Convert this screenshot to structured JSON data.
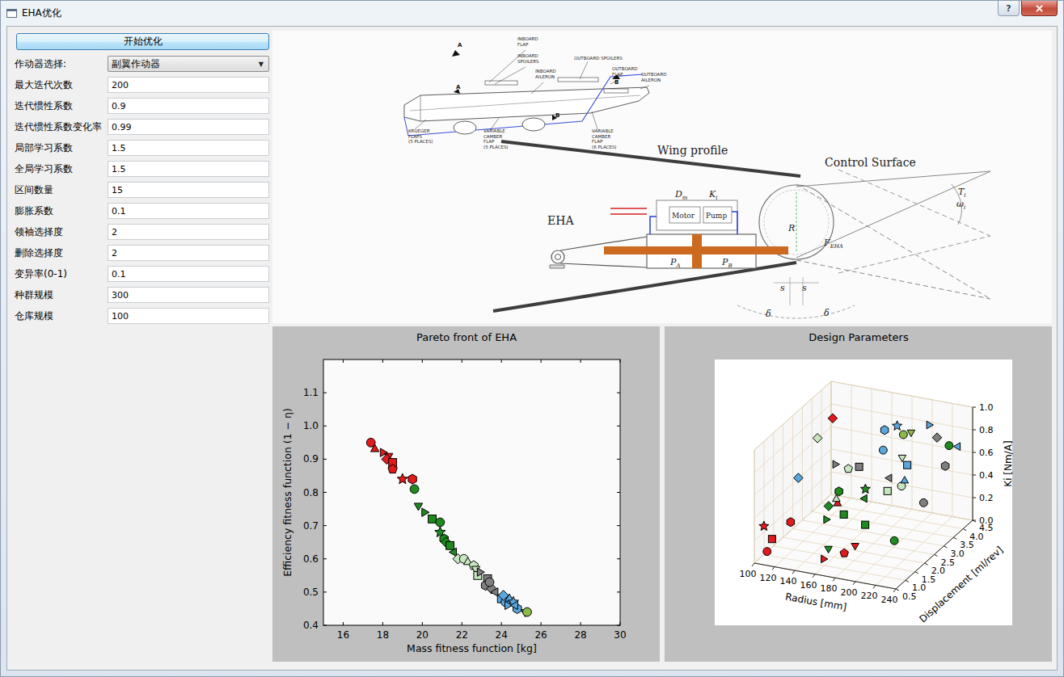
{
  "window": {
    "title": "EHA优化",
    "help": "?",
    "close": "×"
  },
  "sidebar": {
    "start_button": "开始优化",
    "actuator": {
      "label": "作动器选择:",
      "value": "副翼作动器",
      "arrow": "▼"
    },
    "fields": [
      {
        "label": "最大迭代次数",
        "value": "200"
      },
      {
        "label": "迭代惯性系数",
        "value": "0.9"
      },
      {
        "label": "迭代惯性系数变化率",
        "value": "0.99"
      },
      {
        "label": "局部学习系数",
        "value": "1.5"
      },
      {
        "label": "全局学习系数",
        "value": "1.5"
      },
      {
        "label": "区间数量",
        "value": "15"
      },
      {
        "label": "膨胀系数",
        "value": "0.1"
      },
      {
        "label": "领袖选择度",
        "value": "2"
      },
      {
        "label": "删除选择度",
        "value": "2"
      },
      {
        "label": "变异率(0-1)",
        "value": "0.1"
      },
      {
        "label": "种群规模",
        "value": "300"
      },
      {
        "label": "仓库规模",
        "value": "100"
      }
    ]
  },
  "diagram": {
    "airplane_labels": [
      {
        "lines": [
          "INBOARD",
          "FLAP"
        ]
      },
      {
        "lines": [
          "INBOARD",
          "SPOILERS"
        ]
      },
      {
        "lines": [
          "INBOARD",
          "AILERON"
        ]
      },
      {
        "lines": [
          "OUTBOARD SPOILERS"
        ]
      },
      {
        "lines": [
          "OUTBOARD",
          "FLAP"
        ]
      },
      {
        "lines": [
          "OUTBOARD",
          "AILERON"
        ]
      },
      {
        "lines": [
          "KRUEGER",
          "FLAPS",
          "(5 PLACES)"
        ]
      },
      {
        "lines": [
          "VARIABLE",
          "CAMBER",
          "FLAP",
          "(5 PLACES)"
        ]
      },
      {
        "lines": [
          "VARIABLE",
          "CAMBER",
          "FLAP",
          "(6 PLACES)"
        ]
      }
    ],
    "section_markers": [
      "A",
      "A",
      "B",
      "B"
    ],
    "wing_profile": "Wing profile",
    "control_surface": "Control Surface",
    "eha": "EHA",
    "motor": "Motor",
    "pump": "Pump",
    "symbols": [
      {
        "text": "D",
        "sub": "m"
      },
      {
        "text": "K",
        "sub": "i"
      },
      {
        "text": "R",
        "sub": ""
      },
      {
        "text": "P",
        "sub": "A"
      },
      {
        "text": "P",
        "sub": "B"
      },
      {
        "text": "F",
        "sub": "EHA"
      },
      {
        "text": "s",
        "sub": ""
      },
      {
        "text": "s",
        "sub": ""
      },
      {
        "text": "δ",
        "sub": ""
      },
      {
        "text": "δ",
        "sub": ""
      },
      {
        "text": "T",
        "sub": "i"
      },
      {
        "text": "ω",
        "sub": "i"
      }
    ]
  },
  "pareto_chart": {
    "title": "Pareto front of EHA",
    "x_label": "Mass fitness function [kg]",
    "y_label": "Efficiency fitness function (1 − η)",
    "x_range": [
      15,
      30
    ],
    "y_range": [
      0.4,
      1.2
    ],
    "x_ticks": [
      "16",
      "18",
      "20",
      "22",
      "24",
      "26",
      "28",
      "30"
    ],
    "y_ticks": [
      "0.4",
      "0.5",
      "0.6",
      "0.7",
      "0.8",
      "0.9",
      "1.0",
      "1.1"
    ]
  },
  "design_chart": {
    "title": "Design Parameters",
    "x_label": "Radius [mm]",
    "y_label": "Displacement [ml/rev]",
    "z_label": "Ki [Nm/A]",
    "x_range": [
      100,
      240
    ],
    "y_range": [
      0.5,
      4.5
    ],
    "z_range": [
      0,
      1
    ],
    "x_ticks": [
      "100",
      "120",
      "140",
      "160",
      "180",
      "200",
      "220",
      "240"
    ],
    "y_ticks": [
      "0.5",
      "1.0",
      "1.5",
      "2.0",
      "2.5",
      "3.0",
      "3.5",
      "4.0",
      "4.5"
    ],
    "z_ticks": [
      "0.0",
      "0.2",
      "0.4",
      "0.6",
      "0.8",
      "1.0"
    ]
  },
  "designs": [
    {
      "mass": 17.4,
      "efficiency": 0.95,
      "radius": 105,
      "displacement": 0.9,
      "ki": 0.05,
      "color": "#e31a1c",
      "marker": "circle"
    },
    {
      "mass": 17.6,
      "efficiency": 0.93,
      "radius": 150,
      "displacement": 2.2,
      "ki": 0.35,
      "color": "#e31a1c",
      "marker": "triangle"
    },
    {
      "mass": 18.0,
      "efficiency": 0.92,
      "radius": 155,
      "displacement": 1.2,
      "ki": 0.02,
      "color": "#e31a1c",
      "marker": "triangle-right"
    },
    {
      "mass": 18.3,
      "efficiency": 0.91,
      "radius": 175,
      "displacement": 1.8,
      "ki": 0.08,
      "color": "#e31a1c",
      "marker": "triangle-down"
    },
    {
      "mass": 18.2,
      "efficiency": 0.9,
      "radius": 130,
      "displacement": 3.0,
      "ki": 0.95,
      "color": "#e31a1c",
      "marker": "diamond"
    },
    {
      "mass": 18.5,
      "efficiency": 0.89,
      "radius": 108,
      "displacement": 1.0,
      "ki": 0.15,
      "color": "#e31a1c",
      "marker": "square"
    },
    {
      "mass": 18.5,
      "efficiency": 0.87,
      "radius": 170,
      "displacement": 1.5,
      "ki": 0.05,
      "color": "#e31a1c",
      "marker": "pentagon"
    },
    {
      "mass": 19.0,
      "efficiency": 0.84,
      "radius": 100,
      "displacement": 1.0,
      "ki": 0.25,
      "color": "#e31a1c",
      "marker": "star"
    },
    {
      "mass": 19.5,
      "efficiency": 0.84,
      "radius": 115,
      "displacement": 1.6,
      "ki": 0.22,
      "color": "#e31a1c",
      "marker": "hexagon"
    },
    {
      "mass": 19.6,
      "efficiency": 0.81,
      "radius": 210,
      "displacement": 2.0,
      "ki": 0.15,
      "color": "#1f8b1f",
      "marker": "circle"
    },
    {
      "mass": 19.8,
      "efficiency": 0.76,
      "radius": 160,
      "displacement": 1.2,
      "ki": 0.12,
      "color": "#1f8b1f",
      "marker": "triangle-down"
    },
    {
      "mass": 20.1,
      "efficiency": 0.74,
      "radius": 150,
      "displacement": 1.6,
      "ki": 0.3,
      "color": "#1f8b1f",
      "marker": "triangle-right"
    },
    {
      "mass": 20.5,
      "efficiency": 0.72,
      "radius": 185,
      "displacement": 1.8,
      "ki": 0.28,
      "color": "#1f8b1f",
      "marker": "square"
    },
    {
      "mass": 20.9,
      "efficiency": 0.71,
      "radius": 230,
      "displacement": 3.8,
      "ki": 0.75,
      "color": "#1f8b1f",
      "marker": "circle"
    },
    {
      "mass": 20.9,
      "efficiency": 0.68,
      "radius": 170,
      "displacement": 2.6,
      "ki": 0.45,
      "color": "#1f8b1f",
      "marker": "star"
    },
    {
      "mass": 21.1,
      "efficiency": 0.66,
      "radius": 140,
      "displacement": 2.8,
      "ki": 0.35,
      "color": "#1f8b1f",
      "marker": "hexagon"
    },
    {
      "mass": 21.2,
      "efficiency": 0.65,
      "radius": 145,
      "displacement": 2.0,
      "ki": 0.35,
      "color": "#1f8b1f",
      "marker": "diamond"
    },
    {
      "mass": 21.4,
      "efficiency": 0.64,
      "radius": 160,
      "displacement": 2.0,
      "ki": 0.3,
      "color": "#1f8b1f",
      "marker": "square"
    },
    {
      "mass": 21.6,
      "efficiency": 0.62,
      "radius": 175,
      "displacement": 2.3,
      "ki": 0.42,
      "color": "#1f8b1f",
      "marker": "triangle-left"
    },
    {
      "mass": 21.8,
      "efficiency": 0.6,
      "radius": 115,
      "displacement": 3.0,
      "ki": 0.75,
      "color": "#c7e6bf",
      "marker": "diamond"
    },
    {
      "mass": 22.1,
      "efficiency": 0.6,
      "radius": 200,
      "displacement": 2.9,
      "ki": 0.48,
      "color": "#c7e6bf",
      "marker": "circle"
    },
    {
      "mass": 22.3,
      "efficiency": 0.59,
      "radius": 145,
      "displacement": 2.4,
      "ki": 0.35,
      "color": "#c7e6bf",
      "marker": "triangle"
    },
    {
      "mass": 22.6,
      "efficiency": 0.58,
      "radius": 155,
      "displacement": 2.5,
      "ki": 0.62,
      "color": "#c7e6bf",
      "marker": "pentagon"
    },
    {
      "mass": 22.7,
      "efficiency": 0.57,
      "radius": 195,
      "displacement": 3.2,
      "ki": 0.68,
      "color": "#c7e6bf",
      "marker": "triangle-down"
    },
    {
      "mass": 22.8,
      "efficiency": 0.55,
      "radius": 190,
      "displacement": 2.7,
      "ki": 0.45,
      "color": "#c7e6bf",
      "marker": "square"
    },
    {
      "mass": 22.9,
      "efficiency": 0.56,
      "radius": 140,
      "displacement": 2.6,
      "ki": 0.62,
      "color": "#7f7f7f",
      "marker": "triangle-right"
    },
    {
      "mass": 23.3,
      "efficiency": 0.54,
      "radius": 160,
      "displacement": 2.8,
      "ki": 0.6,
      "color": "#7f7f7f",
      "marker": "square"
    },
    {
      "mass": 23.2,
      "efficiency": 0.52,
      "radius": 230,
      "displacement": 3.6,
      "ki": 0.6,
      "color": "#7f7f7f",
      "marker": "hexagon"
    },
    {
      "mass": 23.5,
      "efficiency": 0.51,
      "radius": 220,
      "displacement": 3.7,
      "ki": 0.82,
      "color": "#7f7f7f",
      "marker": "diamond"
    },
    {
      "mass": 23.7,
      "efficiency": 0.5,
      "radius": 190,
      "displacement": 2.8,
      "ki": 0.55,
      "color": "#7f7f7f",
      "marker": "triangle-left"
    },
    {
      "mass": 23.4,
      "efficiency": 0.53,
      "radius": 220,
      "displacement": 3.0,
      "ki": 0.35,
      "color": "#7f7f7f",
      "marker": "circle"
    },
    {
      "mass": 24.0,
      "efficiency": 0.48,
      "radius": 200,
      "displacement": 3.2,
      "ki": 0.62,
      "color": "#5aa7de",
      "marker": "square"
    },
    {
      "mass": 24.2,
      "efficiency": 0.47,
      "radius": 180,
      "displacement": 3.0,
      "ki": 0.75,
      "color": "#5aa7de",
      "marker": "circle"
    },
    {
      "mass": 24.4,
      "efficiency": 0.48,
      "radius": 205,
      "displacement": 2.8,
      "ki": 0.55,
      "color": "#5aa7de",
      "marker": "triangle"
    },
    {
      "mass": 24.6,
      "efficiency": 0.47,
      "radius": 190,
      "displacement": 3.2,
      "ki": 0.95,
      "color": "#5aa7de",
      "marker": "star"
    },
    {
      "mass": 24.8,
      "efficiency": 0.45,
      "radius": 170,
      "displacement": 3.6,
      "ki": 0.82,
      "color": "#5aa7de",
      "marker": "hexagon"
    },
    {
      "mass": 24.1,
      "efficiency": 0.49,
      "radius": 115,
      "displacement": 2.0,
      "ki": 0.55,
      "color": "#5aa7de",
      "marker": "diamond"
    },
    {
      "mass": 24.3,
      "efficiency": 0.46,
      "radius": 210,
      "displacement": 3.8,
      "ki": 0.9,
      "color": "#5aa7de",
      "marker": "triangle-right"
    },
    {
      "mass": 24.7,
      "efficiency": 0.46,
      "radius": 235,
      "displacement": 4.0,
      "ki": 0.72,
      "color": "#5aa7de",
      "marker": "triangle-left"
    },
    {
      "mass": 25.2,
      "efficiency": 0.44,
      "radius": 200,
      "displacement": 3.4,
      "ki": 0.88,
      "color": "#8db84a",
      "marker": "triangle-down"
    },
    {
      "mass": 25.3,
      "efficiency": 0.44,
      "radius": 200,
      "displacement": 3.0,
      "ki": 0.92,
      "color": "#8db84a",
      "marker": "circle"
    }
  ]
}
